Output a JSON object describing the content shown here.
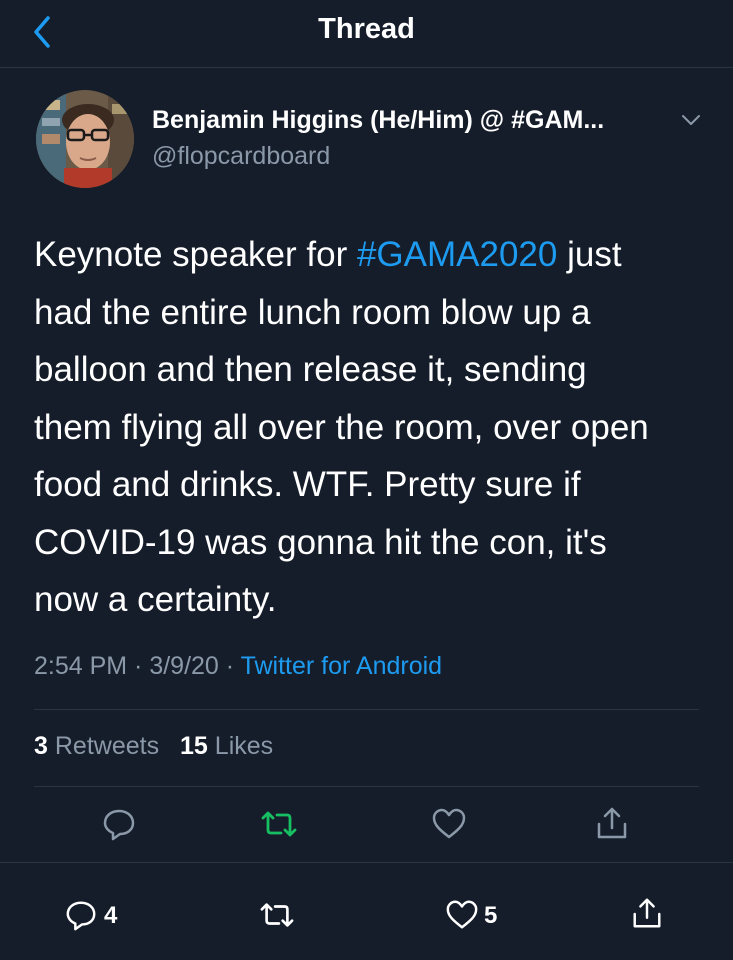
{
  "header": {
    "title": "Thread"
  },
  "author": {
    "name": "Benjamin Higgins (He/Him) @ #GAM...",
    "handle": "@flopcardboard"
  },
  "tweet": {
    "line1_before": "Keynote speaker for ",
    "hashtag": "#GAMA2020",
    "line1_after": " just",
    "line2": "had the entire lunch room blow up a",
    "line3": "balloon and then release it, sending",
    "line4": "them flying all over the room, over open",
    "line5": "food and drinks. WTF. Pretty sure if",
    "line6": "COVID-19 was gonna hit the con, it's",
    "line7": "now a certainty."
  },
  "meta": {
    "time": "2:54 PM",
    "sep1": " · ",
    "date": "3/9/20",
    "sep2": " · ",
    "source": "Twitter for Android"
  },
  "stats": {
    "retweets_count": "3",
    "retweets_label": "Retweets",
    "likes_count": "15",
    "likes_label": "Likes"
  },
  "bottom_bar": {
    "reply_count": "4",
    "like_count": "5"
  },
  "colors": {
    "background": "#151d2a",
    "accent": "#1d9bf0",
    "retweet_green": "#17bf63",
    "muted": "#8a98a8"
  },
  "icons": {
    "back": "chevron-left-icon",
    "more": "chevron-down-icon",
    "reply": "reply-icon",
    "retweet": "retweet-icon",
    "like": "heart-icon",
    "share": "share-icon"
  }
}
